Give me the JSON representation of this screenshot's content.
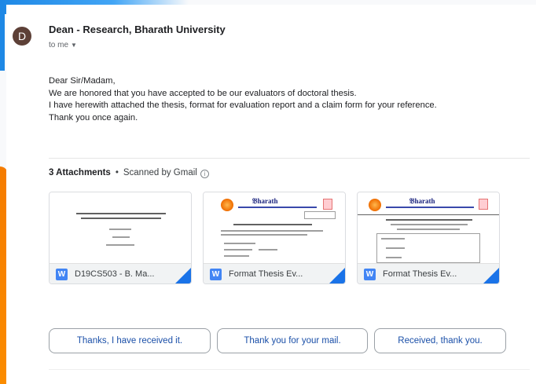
{
  "email": {
    "sender_initial": "D",
    "sender_name": "Dean - Research, Bharath University",
    "recipient_line": "to me",
    "body_lines": [
      "Dear Sir/Madam,",
      "We are honored that you have accepted to be our evaluators of doctoral thesis.",
      "I have herewith attached the thesis, format for evaluation report and a claim form for your reference.",
      "Thank you once again."
    ]
  },
  "attachments": {
    "count_label": "3 Attachments",
    "separator": "•",
    "scanned_label": "Scanned by Gmail",
    "info_symbol": "i",
    "items": [
      {
        "file_type_icon": "W",
        "name": "D19CS503 - B. Ma..."
      },
      {
        "file_type_icon": "W",
        "name": "Format Thesis Ev..."
      },
      {
        "file_type_icon": "W",
        "name": "Format Thesis Ev..."
      }
    ]
  },
  "smart_replies": [
    "Thanks, I have received it.",
    "Thank you for your mail.",
    "Received, thank you."
  ],
  "colors": {
    "accent_blue": "#1a73e8",
    "word_blue": "#4285f4",
    "avatar": "#5d4037",
    "edge_orange": "#f57c00"
  }
}
